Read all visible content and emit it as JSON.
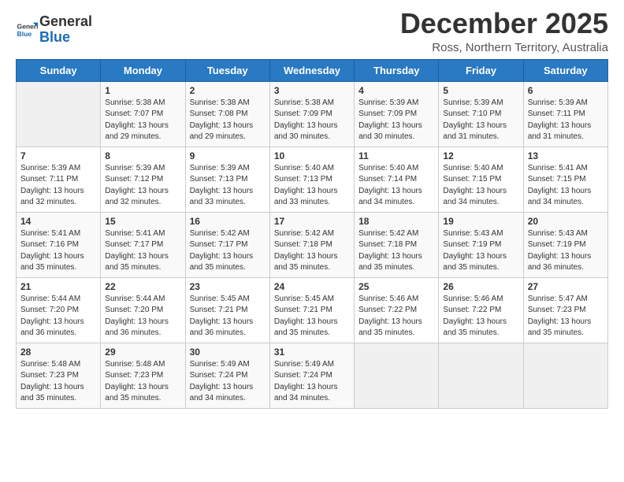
{
  "logo": {
    "general": "General",
    "blue": "Blue"
  },
  "title": "December 2025",
  "location": "Ross, Northern Territory, Australia",
  "days_of_week": [
    "Sunday",
    "Monday",
    "Tuesday",
    "Wednesday",
    "Thursday",
    "Friday",
    "Saturday"
  ],
  "weeks": [
    [
      {
        "day": "",
        "empty": true
      },
      {
        "day": "1",
        "sunrise": "5:38 AM",
        "sunset": "7:07 PM",
        "daylight": "13 hours and 29 minutes."
      },
      {
        "day": "2",
        "sunrise": "5:38 AM",
        "sunset": "7:08 PM",
        "daylight": "13 hours and 29 minutes."
      },
      {
        "day": "3",
        "sunrise": "5:38 AM",
        "sunset": "7:09 PM",
        "daylight": "13 hours and 30 minutes."
      },
      {
        "day": "4",
        "sunrise": "5:39 AM",
        "sunset": "7:09 PM",
        "daylight": "13 hours and 30 minutes."
      },
      {
        "day": "5",
        "sunrise": "5:39 AM",
        "sunset": "7:10 PM",
        "daylight": "13 hours and 31 minutes."
      },
      {
        "day": "6",
        "sunrise": "5:39 AM",
        "sunset": "7:11 PM",
        "daylight": "13 hours and 31 minutes."
      }
    ],
    [
      {
        "day": "7",
        "sunrise": "5:39 AM",
        "sunset": "7:11 PM",
        "daylight": "13 hours and 32 minutes."
      },
      {
        "day": "8",
        "sunrise": "5:39 AM",
        "sunset": "7:12 PM",
        "daylight": "13 hours and 32 minutes."
      },
      {
        "day": "9",
        "sunrise": "5:39 AM",
        "sunset": "7:13 PM",
        "daylight": "13 hours and 33 minutes."
      },
      {
        "day": "10",
        "sunrise": "5:40 AM",
        "sunset": "7:13 PM",
        "daylight": "13 hours and 33 minutes."
      },
      {
        "day": "11",
        "sunrise": "5:40 AM",
        "sunset": "7:14 PM",
        "daylight": "13 hours and 34 minutes."
      },
      {
        "day": "12",
        "sunrise": "5:40 AM",
        "sunset": "7:15 PM",
        "daylight": "13 hours and 34 minutes."
      },
      {
        "day": "13",
        "sunrise": "5:41 AM",
        "sunset": "7:15 PM",
        "daylight": "13 hours and 34 minutes."
      }
    ],
    [
      {
        "day": "14",
        "sunrise": "5:41 AM",
        "sunset": "7:16 PM",
        "daylight": "13 hours and 35 minutes."
      },
      {
        "day": "15",
        "sunrise": "5:41 AM",
        "sunset": "7:17 PM",
        "daylight": "13 hours and 35 minutes."
      },
      {
        "day": "16",
        "sunrise": "5:42 AM",
        "sunset": "7:17 PM",
        "daylight": "13 hours and 35 minutes."
      },
      {
        "day": "17",
        "sunrise": "5:42 AM",
        "sunset": "7:18 PM",
        "daylight": "13 hours and 35 minutes."
      },
      {
        "day": "18",
        "sunrise": "5:42 AM",
        "sunset": "7:18 PM",
        "daylight": "13 hours and 35 minutes."
      },
      {
        "day": "19",
        "sunrise": "5:43 AM",
        "sunset": "7:19 PM",
        "daylight": "13 hours and 35 minutes."
      },
      {
        "day": "20",
        "sunrise": "5:43 AM",
        "sunset": "7:19 PM",
        "daylight": "13 hours and 36 minutes."
      }
    ],
    [
      {
        "day": "21",
        "sunrise": "5:44 AM",
        "sunset": "7:20 PM",
        "daylight": "13 hours and 36 minutes."
      },
      {
        "day": "22",
        "sunrise": "5:44 AM",
        "sunset": "7:20 PM",
        "daylight": "13 hours and 36 minutes."
      },
      {
        "day": "23",
        "sunrise": "5:45 AM",
        "sunset": "7:21 PM",
        "daylight": "13 hours and 36 minutes."
      },
      {
        "day": "24",
        "sunrise": "5:45 AM",
        "sunset": "7:21 PM",
        "daylight": "13 hours and 35 minutes."
      },
      {
        "day": "25",
        "sunrise": "5:46 AM",
        "sunset": "7:22 PM",
        "daylight": "13 hours and 35 minutes."
      },
      {
        "day": "26",
        "sunrise": "5:46 AM",
        "sunset": "7:22 PM",
        "daylight": "13 hours and 35 minutes."
      },
      {
        "day": "27",
        "sunrise": "5:47 AM",
        "sunset": "7:23 PM",
        "daylight": "13 hours and 35 minutes."
      }
    ],
    [
      {
        "day": "28",
        "sunrise": "5:48 AM",
        "sunset": "7:23 PM",
        "daylight": "13 hours and 35 minutes."
      },
      {
        "day": "29",
        "sunrise": "5:48 AM",
        "sunset": "7:23 PM",
        "daylight": "13 hours and 35 minutes."
      },
      {
        "day": "30",
        "sunrise": "5:49 AM",
        "sunset": "7:24 PM",
        "daylight": "13 hours and 34 minutes."
      },
      {
        "day": "31",
        "sunrise": "5:49 AM",
        "sunset": "7:24 PM",
        "daylight": "13 hours and 34 minutes."
      },
      {
        "day": "",
        "empty": true
      },
      {
        "day": "",
        "empty": true
      },
      {
        "day": "",
        "empty": true
      }
    ]
  ],
  "labels": {
    "sunrise": "Sunrise:",
    "sunset": "Sunset:",
    "daylight": "Daylight:"
  }
}
